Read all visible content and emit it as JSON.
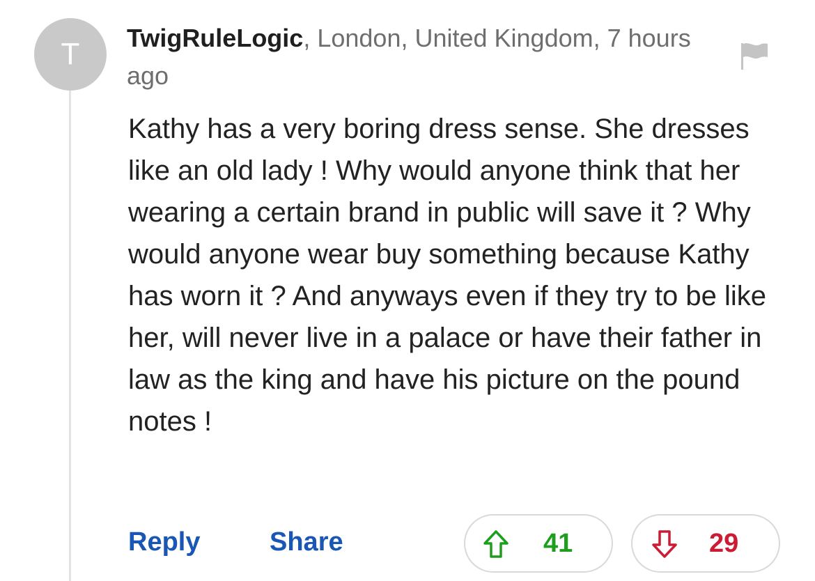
{
  "comment": {
    "avatar_initial": "T",
    "username": "TwigRuleLogic",
    "meta_suffix": ", London, United Kingdom, 7 hours ago",
    "body": "Kathy has a very boring dress sense. She dresses like an old lady ! Why would anyone think that her wearing a certain brand in public will save it ? Why would anyone wear buy something because Kathy has worn it ? And anyways even if they try to be like her, will never live in a palace or have their father in law as the king and have his picture on the pound notes !",
    "flag_icon": "flag-icon"
  },
  "actions": {
    "reply_label": "Reply",
    "share_label": "Share"
  },
  "votes": {
    "up_icon": "arrow-up-icon",
    "up_count": "41",
    "up_color": "#1e9e1e",
    "down_icon": "arrow-down-icon",
    "down_count": "29",
    "down_color": "#cc1b33"
  },
  "colors": {
    "link": "#1a56b3",
    "avatar_bg": "#c9c9c9",
    "meta_text": "#6e6e6e"
  }
}
